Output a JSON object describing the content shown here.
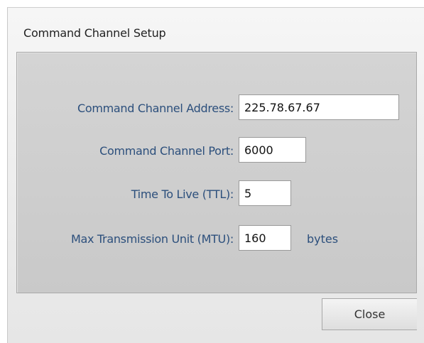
{
  "dialog": {
    "title": "Command Channel Setup"
  },
  "form": {
    "address": {
      "label": "Command Channel Address:",
      "value": "225.78.67.67"
    },
    "port": {
      "label": "Command Channel Port:",
      "value": "6000"
    },
    "ttl": {
      "label": "Time To Live (TTL):",
      "value": "5"
    },
    "mtu": {
      "label": "Max Transmission Unit (MTU):",
      "value": "160",
      "unit": "bytes"
    }
  },
  "footer": {
    "close_label": "Close"
  }
}
